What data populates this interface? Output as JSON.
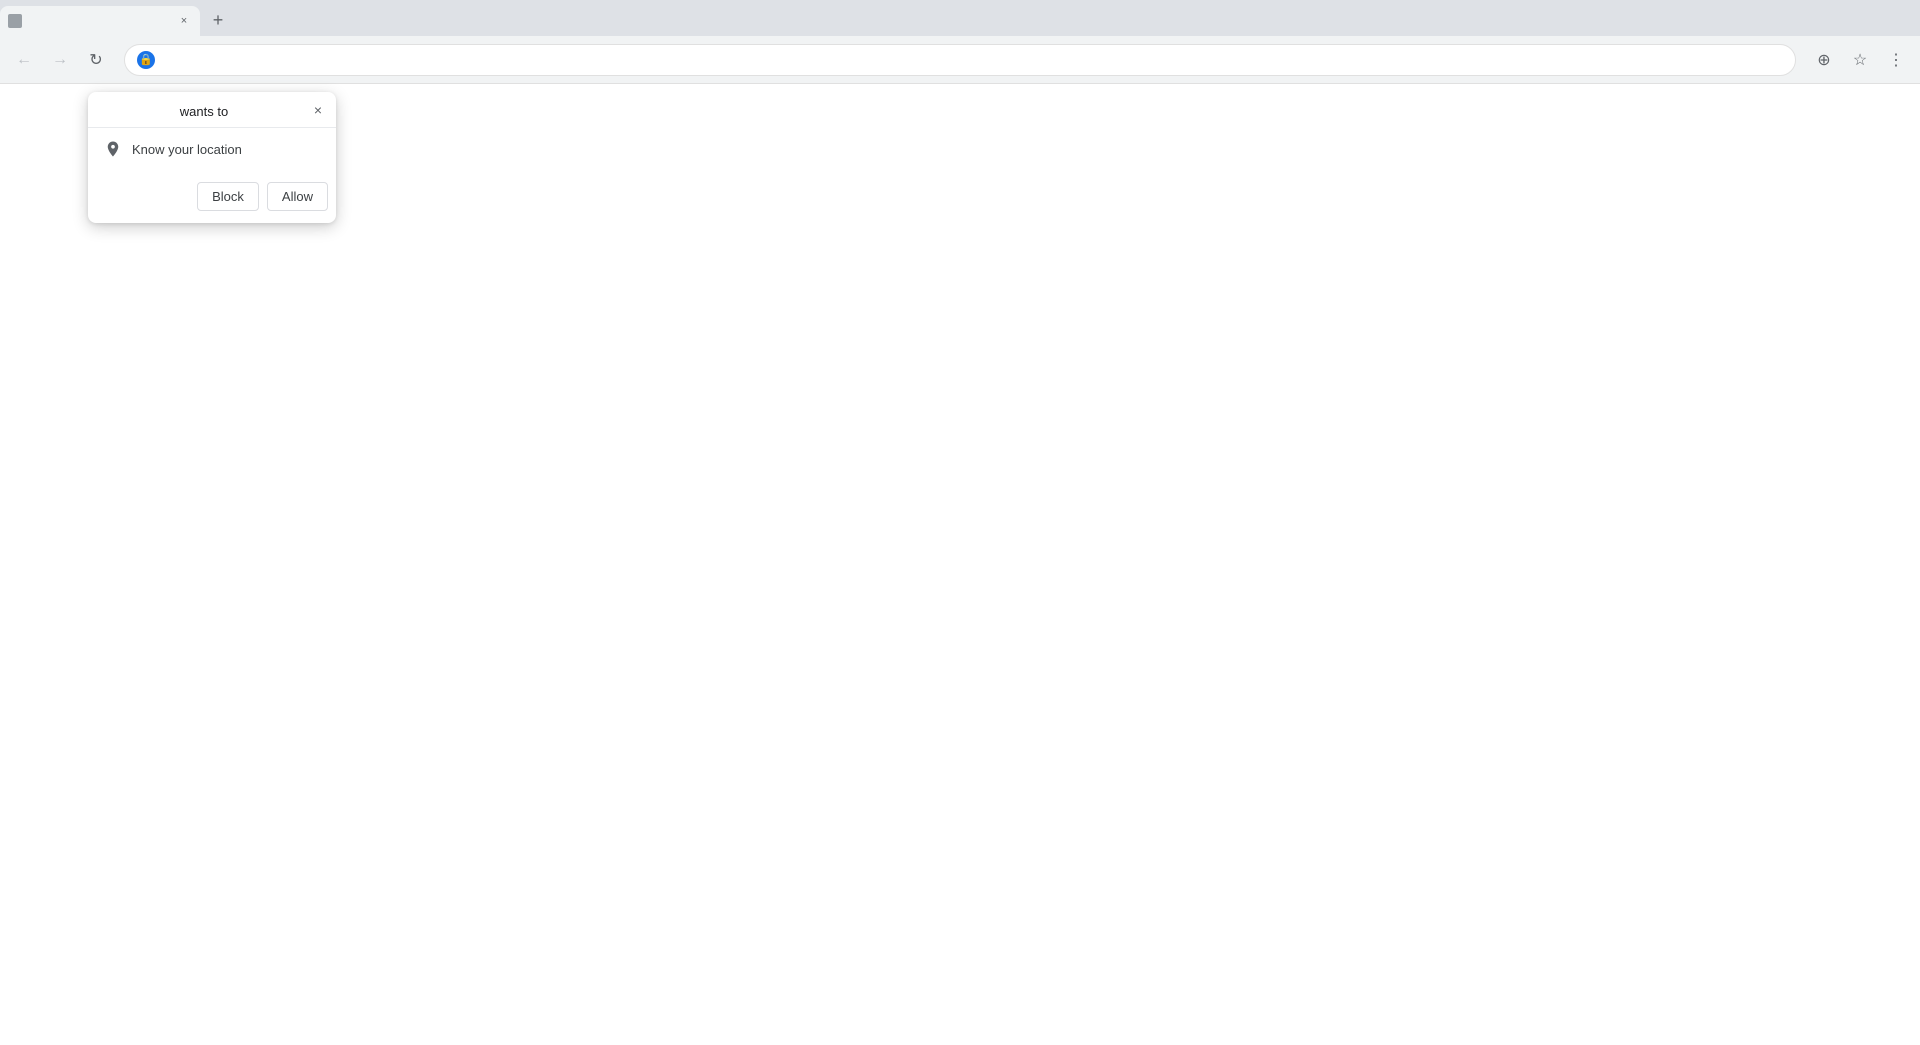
{
  "browser": {
    "tab": {
      "title": "",
      "close_label": "×",
      "new_tab_label": "+"
    },
    "nav": {
      "back_label": "←",
      "forward_label": "→",
      "refresh_label": "↻",
      "security_icon_label": "🔒",
      "address": "",
      "bookmark_icon": "☆",
      "menu_icon": "⋮",
      "location_icon": "⊕"
    }
  },
  "popup": {
    "title": "wants to",
    "close_label": "×",
    "permission_text": "Know your location",
    "block_label": "Block",
    "allow_label": "Allow"
  },
  "page": {
    "background": "#ffffff"
  }
}
